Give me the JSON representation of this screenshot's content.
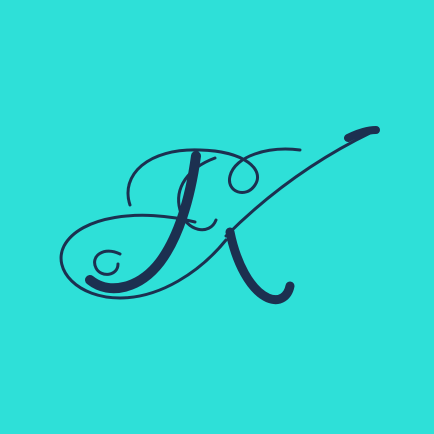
{
  "app_icon": {
    "monogram_letter": "K",
    "icon_name": "script-k-monogram-icon",
    "colors": {
      "background": "#2ee0d8",
      "ink": "#1c3050"
    }
  }
}
